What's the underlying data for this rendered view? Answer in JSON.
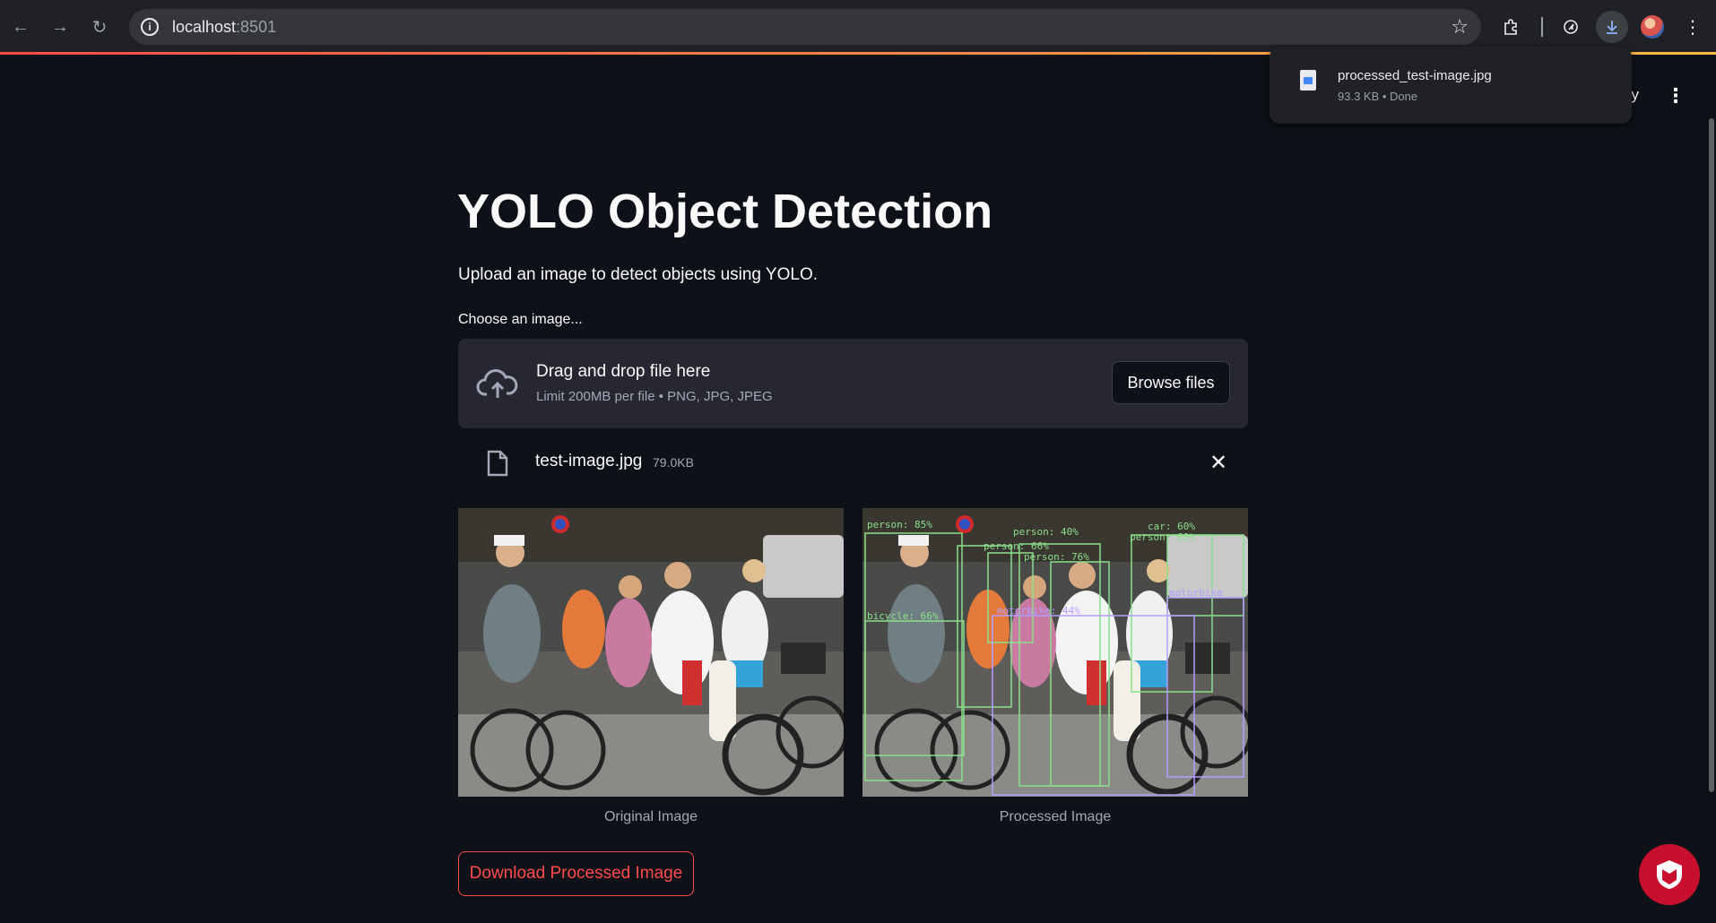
{
  "browser": {
    "url_host": "localhost",
    "url_port": ":8501"
  },
  "download_bubble": {
    "file_name": "processed_test-image.jpg",
    "meta": "93.3 KB • Done"
  },
  "header": {
    "deploy_fragment": "oy"
  },
  "main": {
    "title": "YOLO Object Detection",
    "subtitle": "Upload an image to detect objects using YOLO.",
    "uploader": {
      "label": "Choose an image...",
      "drag_text": "Drag and drop file here",
      "limit_text": "Limit 200MB per file • PNG, JPG, JPEG",
      "browse_label": "Browse files"
    },
    "uploaded_file": {
      "name": "test-image.jpg",
      "size": "79.0KB"
    },
    "images": {
      "original_caption": "Original Image",
      "processed_caption": "Processed Image",
      "detections": [
        {
          "label": "person: 85%"
        },
        {
          "label": "person: 40%"
        },
        {
          "label": "car: 60%"
        },
        {
          "label": "person: 60%"
        },
        {
          "label": "person: 66%"
        },
        {
          "label": "person: 76%"
        },
        {
          "label": "bicycle: 66%"
        },
        {
          "label": "motorbike: 44%"
        },
        {
          "label": "motorbike"
        }
      ]
    },
    "download_label": "Download Processed Image"
  },
  "colors": {
    "background": "#0e1117",
    "accent": "#ff4b4b",
    "dropzone": "#262730",
    "detection_green": "#8be08b",
    "detection_purple": "#b49cff"
  },
  "icons": {
    "back": "arrow-left-icon",
    "forward": "arrow-right-icon",
    "reload": "reload-icon",
    "info": "info-icon",
    "bookmark": "star-icon",
    "extensions": "puzzle-icon",
    "download": "download-icon",
    "upload": "cloud-upload-icon",
    "file": "file-icon",
    "close": "close-icon"
  }
}
